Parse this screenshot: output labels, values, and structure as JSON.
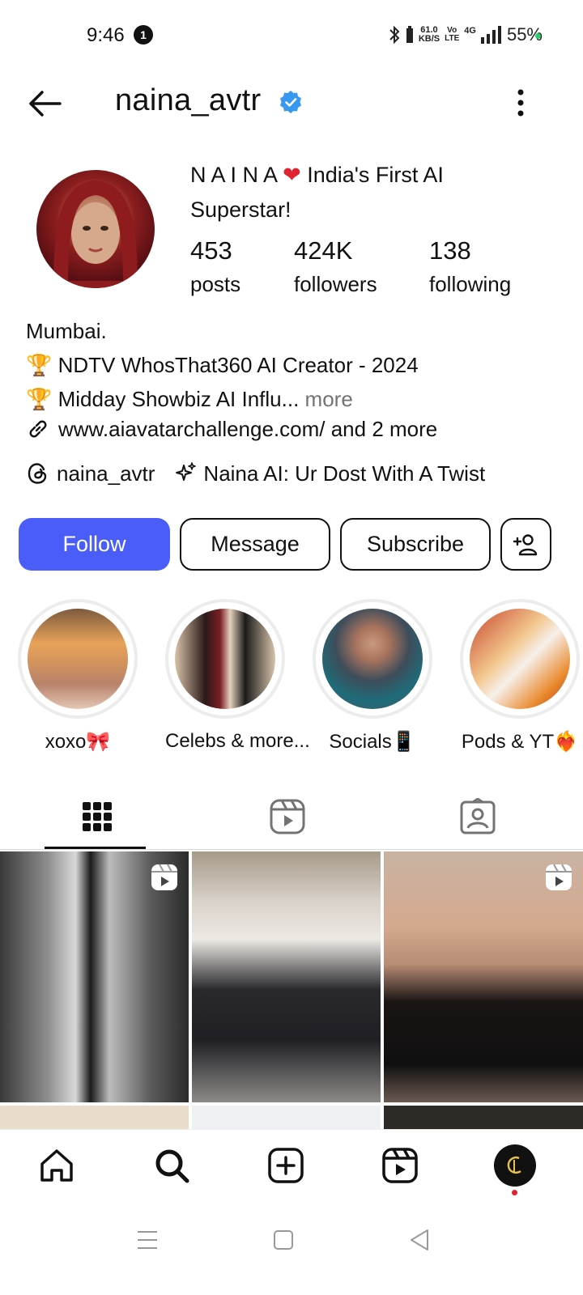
{
  "status_bar": {
    "time": "9:46",
    "notification_count": "1",
    "net_speed_value": "61.0",
    "net_speed_unit": "KB/S",
    "volte_top": "Vo",
    "volte_bottom": "LTE",
    "network": "4G",
    "battery": "55%"
  },
  "header": {
    "username": "naina_avtr",
    "verified": true
  },
  "profile": {
    "name_part": "N A I N A",
    "name_rest": " India's First AI Superstar!",
    "stats": [
      {
        "value": "453",
        "label": "posts"
      },
      {
        "value": "424K",
        "label": "followers"
      },
      {
        "value": "138",
        "label": "following"
      }
    ],
    "bio": {
      "location": "Mumbai.",
      "line1": "🏆 NDTV WhosThat360 AI Creator - 2024",
      "line2": "🏆 Midday Showbiz AI Influ...",
      "more": "more",
      "link": "www.aiavatarchallenge.com/ and 2 more"
    },
    "threads_handle": "naina_avtr",
    "ai_label": "Naina AI: Ur Dost With A Twist"
  },
  "buttons": {
    "follow": "Follow",
    "message": "Message",
    "subscribe": "Subscribe"
  },
  "highlights": [
    {
      "label": "xoxo🎀"
    },
    {
      "label": "Celebs & more..."
    },
    {
      "label": "Socials📱"
    },
    {
      "label": "Pods & YT❤️‍🔥"
    }
  ],
  "colors": {
    "accent": "#4a5df9",
    "verified": "#3897f0"
  }
}
